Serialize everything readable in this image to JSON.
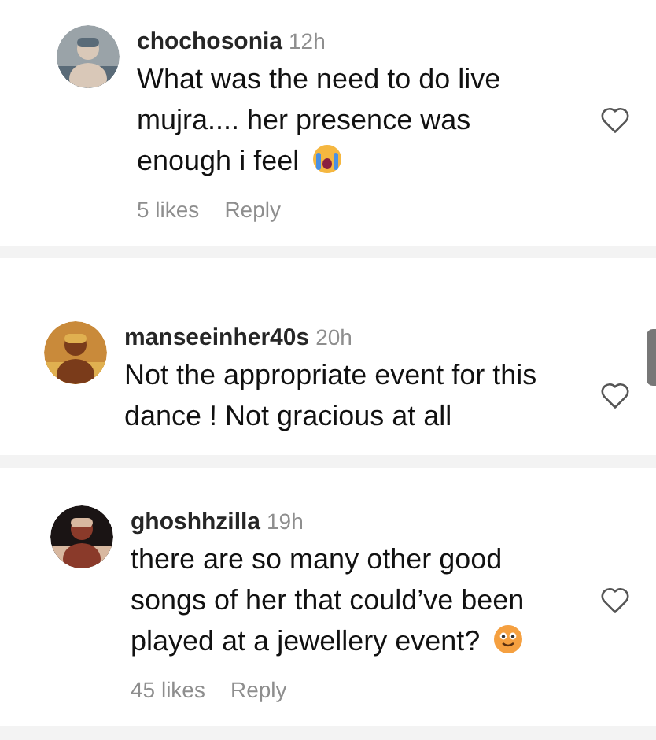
{
  "comments": [
    {
      "username": "chochosonia",
      "time": "12h",
      "text": "What was the need to do live mujra.... her presence was enough i feel",
      "emoji": {
        "kind": "crying"
      },
      "liked": false,
      "likes": "5 likes",
      "reply": "Reply"
    },
    {
      "username": "manseeinher40s",
      "time": "20h",
      "text": "Not the appropriate event for this dance ! Not gracious at all",
      "liked": false
    },
    {
      "username": "ghoshhzilla",
      "time": "19h",
      "text": "there are so many other good songs of her that could’ve been played at a jewellery event?",
      "emoji": {
        "kind": "smile"
      },
      "liked": false,
      "likes": "45 likes",
      "reply": "Reply"
    }
  ]
}
